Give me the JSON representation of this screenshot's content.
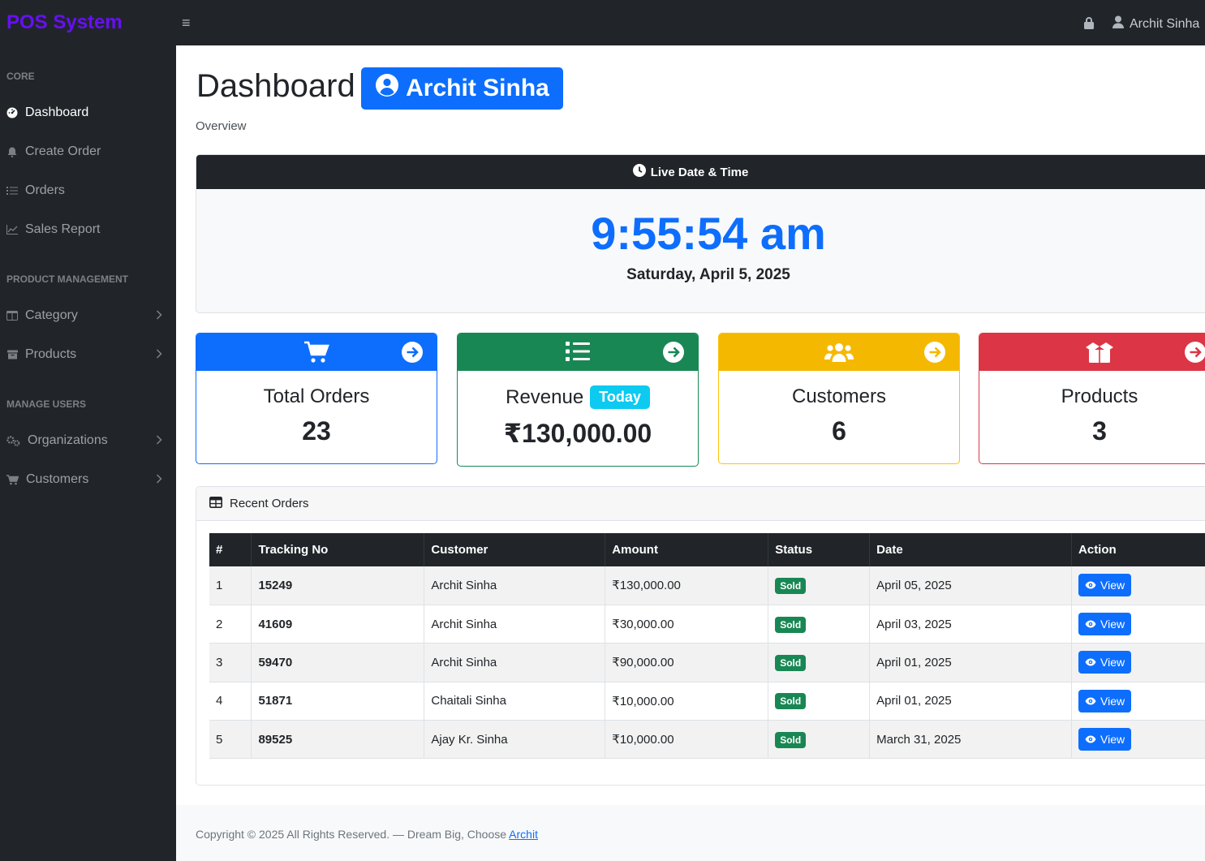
{
  "brand": "POS System",
  "topbar": {
    "user_name": "Archit Sinha"
  },
  "sidebar": {
    "headings": {
      "core": "CORE",
      "product_management": "PRODUCT MANAGEMENT",
      "manage_users": "MANAGE USERS"
    },
    "items": {
      "dashboard": "Dashboard",
      "create_order": "Create Order",
      "orders": "Orders",
      "sales_report": "Sales Report",
      "category": "Category",
      "products": "Products",
      "organizations": "Organizations",
      "customers": "Customers"
    }
  },
  "page": {
    "title": "Dashboard",
    "user_badge": "Archit Sinha",
    "subtitle": "Overview"
  },
  "clock": {
    "header": "Live Date & Time",
    "time": "9:55:54 am",
    "date": "Saturday, April 5, 2025"
  },
  "stats": {
    "total_orders": {
      "label": "Total Orders",
      "value": "23",
      "color": "#0d6efd"
    },
    "revenue": {
      "label": "Revenue",
      "badge": "Today",
      "value": "₹130,000.00",
      "color": "#198754"
    },
    "customers": {
      "label": "Customers",
      "value": "6",
      "color": "#ffc107"
    },
    "products": {
      "label": "Products",
      "value": "3",
      "color": "#dc3545"
    }
  },
  "recent_orders": {
    "title": "Recent Orders",
    "columns": [
      "#",
      "Tracking No",
      "Customer",
      "Amount",
      "Status",
      "Date",
      "Action"
    ],
    "rows": [
      {
        "num": "1",
        "tracking": "15249",
        "customer": "Archit Sinha",
        "amount": "₹130,000.00",
        "status": "Sold",
        "date": "April 05, 2025",
        "action": "View"
      },
      {
        "num": "2",
        "tracking": "41609",
        "customer": "Archit Sinha",
        "amount": "₹30,000.00",
        "status": "Sold",
        "date": "April 03, 2025",
        "action": "View"
      },
      {
        "num": "3",
        "tracking": "59470",
        "customer": "Archit Sinha",
        "amount": "₹90,000.00",
        "status": "Sold",
        "date": "April 01, 2025",
        "action": "View"
      },
      {
        "num": "4",
        "tracking": "51871",
        "customer": "Chaitali Sinha",
        "amount": "₹10,000.00",
        "status": "Sold",
        "date": "April 01, 2025",
        "action": "View"
      },
      {
        "num": "5",
        "tracking": "89525",
        "customer": "Ajay Kr. Sinha",
        "amount": "₹10,000.00",
        "status": "Sold",
        "date": "March 31, 2025",
        "action": "View"
      }
    ]
  },
  "footer": {
    "text": "Copyright © 2025 All Rights Reserved. — Dream Big, Choose",
    "link": "Archit"
  }
}
